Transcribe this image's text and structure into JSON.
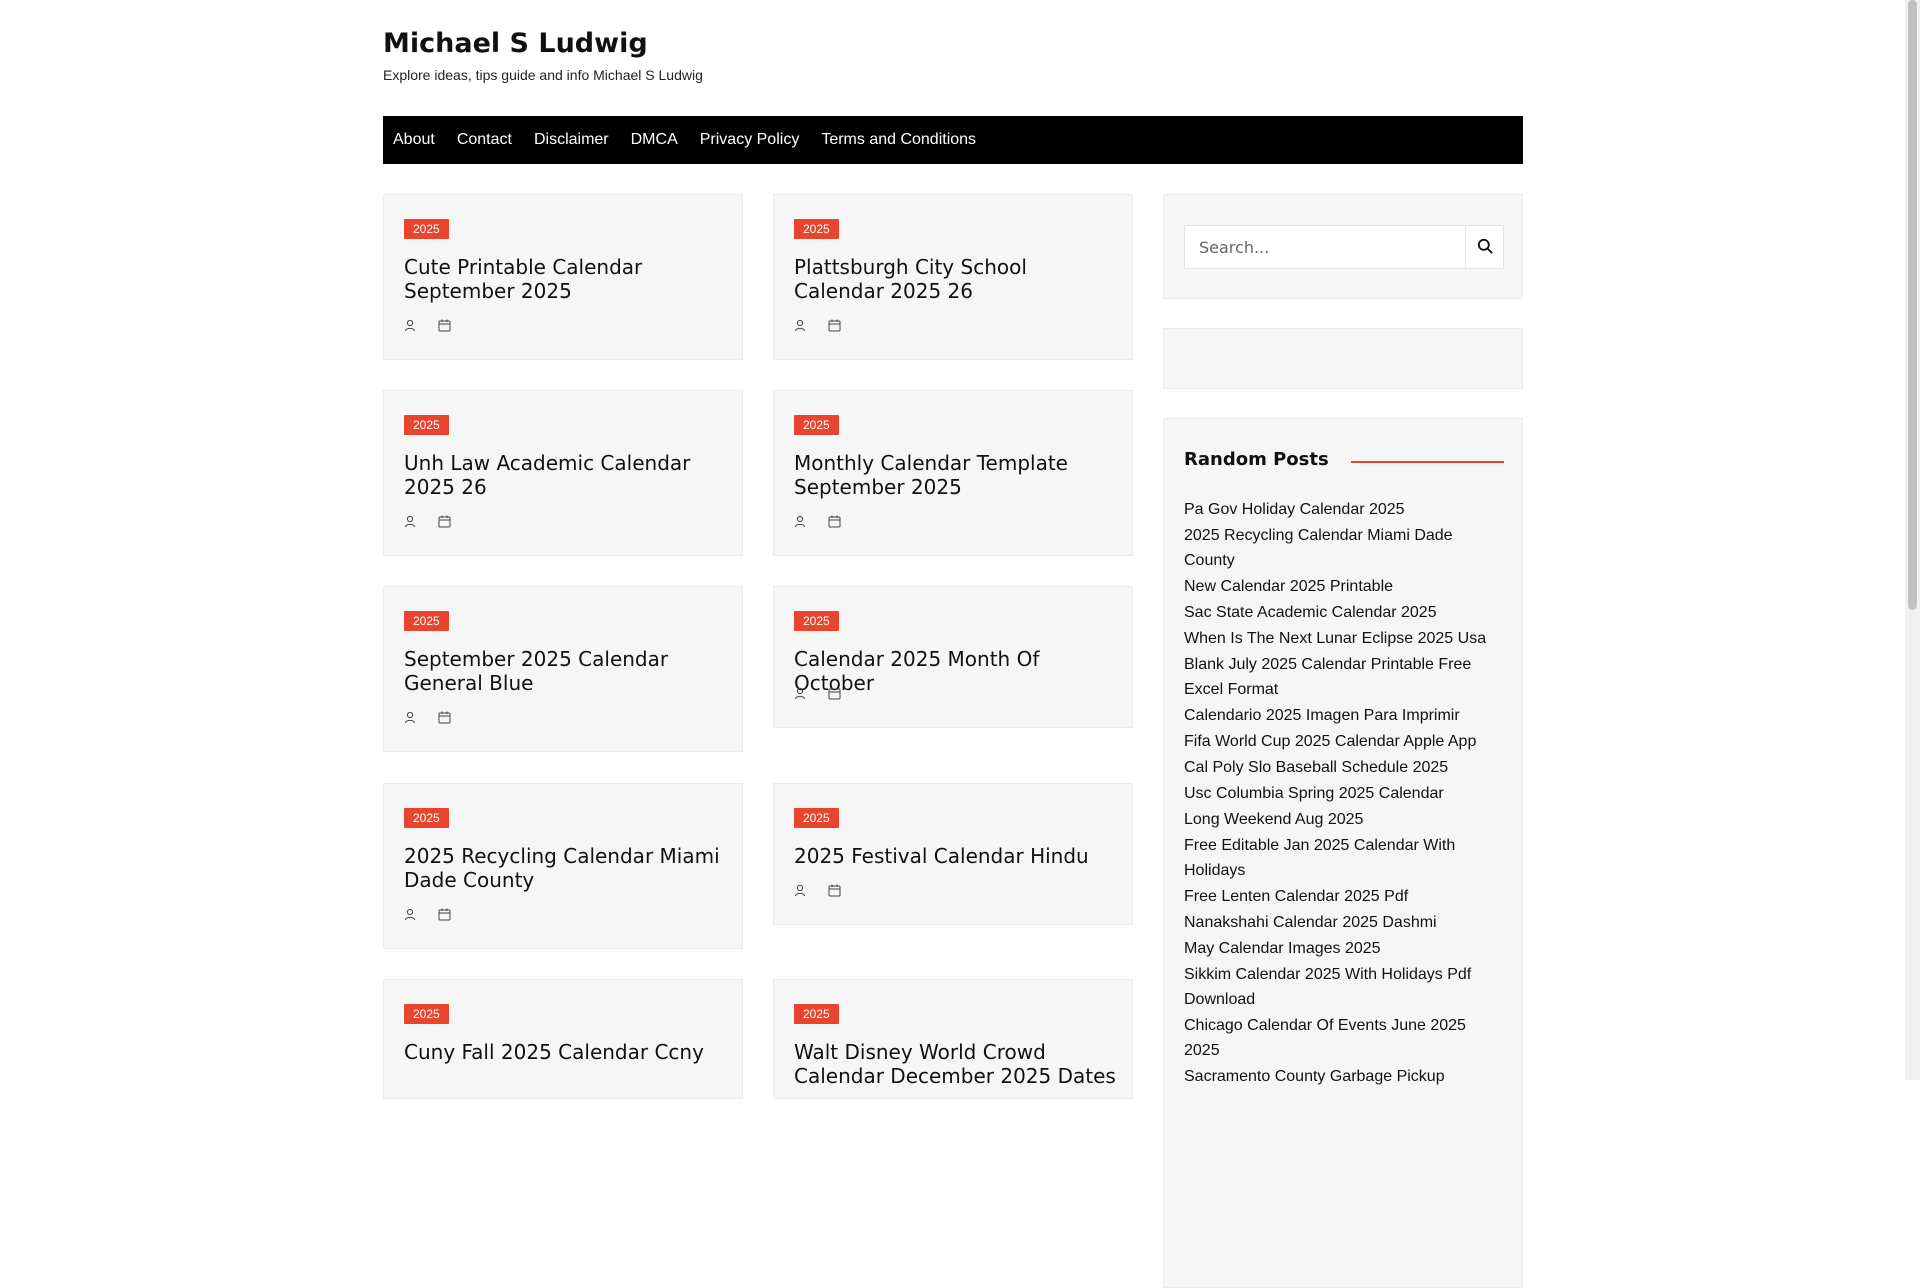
{
  "site": {
    "title": "Michael S Ludwig",
    "description": "Explore ideas, tips guide and info Michael S Ludwig"
  },
  "nav": [
    "About",
    "Contact",
    "Disclaimer",
    "DMCA",
    "Privacy Policy",
    "Terms and Conditions"
  ],
  "posts": [
    {
      "tag": "2025",
      "title": "Cute Printable Calendar September 2025"
    },
    {
      "tag": "2025",
      "title": "Plattsburgh City School Calendar 2025 26"
    },
    {
      "tag": "2025",
      "title": "Unh Law Academic Calendar 2025 26"
    },
    {
      "tag": "2025",
      "title": "Monthly Calendar Template September 2025"
    },
    {
      "tag": "2025",
      "title": "September 2025 Calendar General Blue"
    },
    {
      "tag": "2025",
      "title": "Calendar 2025 Month Of October"
    },
    {
      "tag": "2025",
      "title": "2025 Recycling Calendar Miami Dade County"
    },
    {
      "tag": "2025",
      "title": "2025 Festival Calendar Hindu"
    },
    {
      "tag": "2025",
      "title": "Cuny Fall 2025 Calendar Ccny"
    },
    {
      "tag": "2025",
      "title": "Walt Disney World Crowd Calendar December 2025 Dates"
    }
  ],
  "sidebar": {
    "search_placeholder": "Search...",
    "random_posts_title": "Random Posts",
    "random_posts": [
      "Pa Gov Holiday Calendar 2025",
      "2025 Recycling Calendar Miami Dade County",
      "New Calendar 2025 Printable",
      "Sac State Academic Calendar 2025",
      "When Is The Next Lunar Eclipse 2025 Usa",
      "Blank July 2025 Calendar Printable Free Excel Format",
      "Calendario 2025 Imagen Para Imprimir",
      "Fifa World Cup 2025 Calendar Apple App",
      "Cal Poly Slo Baseball Schedule 2025",
      "Usc Columbia Spring 2025 Calendar",
      "Long Weekend Aug 2025",
      "Free Editable Jan 2025 Calendar With Holidays",
      "Free Lenten Calendar 2025 Pdf",
      "Nanakshahi Calendar 2025 Dashmi",
      "May Calendar Images 2025",
      "Sikkim Calendar 2025 With Holidays Pdf Download",
      "Chicago Calendar Of Events June 2025 2025",
      "Sacramento County Garbage Pickup"
    ]
  },
  "colors": {
    "accent": "#e8442e",
    "nav_bg": "#000000",
    "card_bg": "#f6f6f6"
  },
  "icons": {
    "author": "user-icon",
    "date": "calendar-icon",
    "search": "search-icon"
  }
}
